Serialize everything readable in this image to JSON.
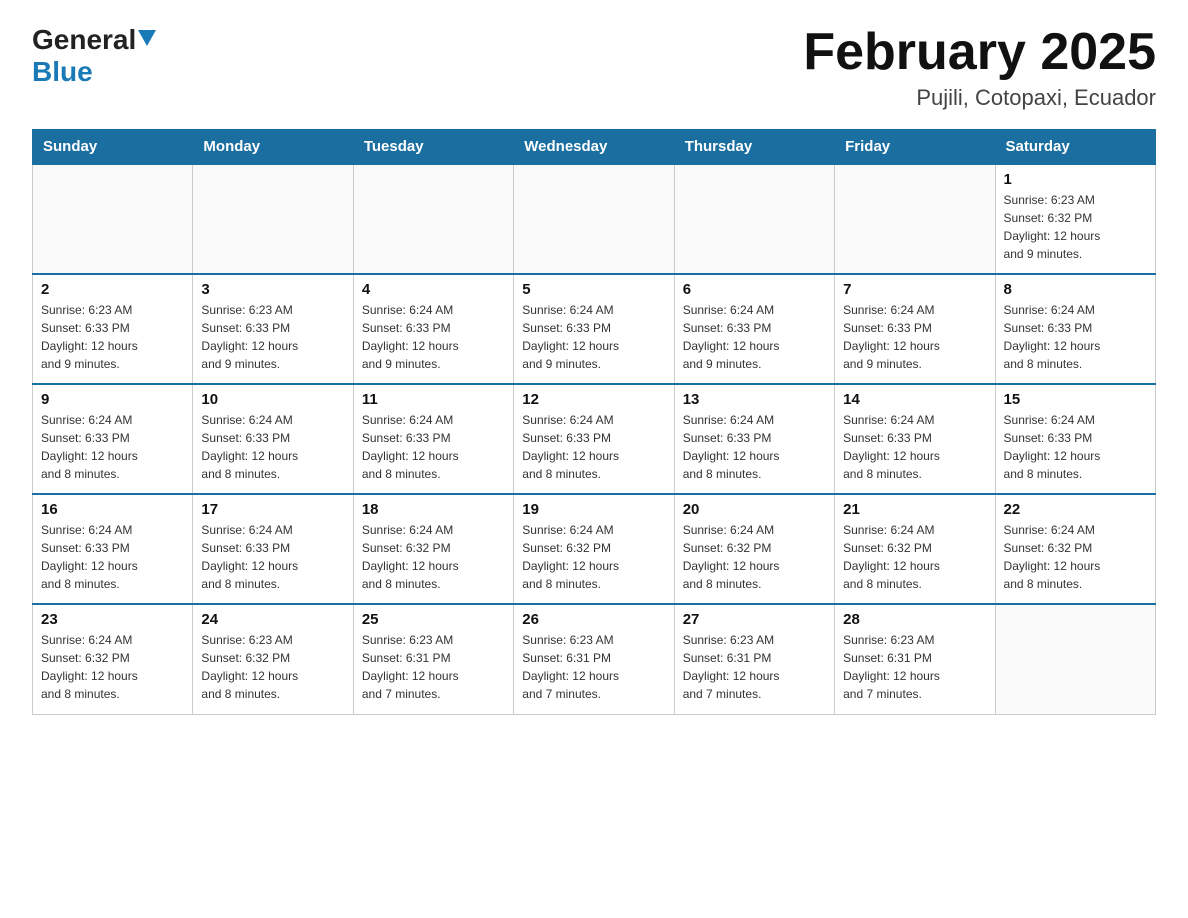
{
  "logo": {
    "general": "General",
    "blue": "Blue",
    "arrow_char": "▼"
  },
  "header": {
    "month_title": "February 2025",
    "location": "Pujili, Cotopaxi, Ecuador"
  },
  "weekdays": [
    "Sunday",
    "Monday",
    "Tuesday",
    "Wednesday",
    "Thursday",
    "Friday",
    "Saturday"
  ],
  "weeks": [
    {
      "days": [
        {
          "num": "",
          "info": ""
        },
        {
          "num": "",
          "info": ""
        },
        {
          "num": "",
          "info": ""
        },
        {
          "num": "",
          "info": ""
        },
        {
          "num": "",
          "info": ""
        },
        {
          "num": "",
          "info": ""
        },
        {
          "num": "1",
          "info": "Sunrise: 6:23 AM\nSunset: 6:32 PM\nDaylight: 12 hours\nand 9 minutes."
        }
      ]
    },
    {
      "days": [
        {
          "num": "2",
          "info": "Sunrise: 6:23 AM\nSunset: 6:33 PM\nDaylight: 12 hours\nand 9 minutes."
        },
        {
          "num": "3",
          "info": "Sunrise: 6:23 AM\nSunset: 6:33 PM\nDaylight: 12 hours\nand 9 minutes."
        },
        {
          "num": "4",
          "info": "Sunrise: 6:24 AM\nSunset: 6:33 PM\nDaylight: 12 hours\nand 9 minutes."
        },
        {
          "num": "5",
          "info": "Sunrise: 6:24 AM\nSunset: 6:33 PM\nDaylight: 12 hours\nand 9 minutes."
        },
        {
          "num": "6",
          "info": "Sunrise: 6:24 AM\nSunset: 6:33 PM\nDaylight: 12 hours\nand 9 minutes."
        },
        {
          "num": "7",
          "info": "Sunrise: 6:24 AM\nSunset: 6:33 PM\nDaylight: 12 hours\nand 9 minutes."
        },
        {
          "num": "8",
          "info": "Sunrise: 6:24 AM\nSunset: 6:33 PM\nDaylight: 12 hours\nand 8 minutes."
        }
      ]
    },
    {
      "days": [
        {
          "num": "9",
          "info": "Sunrise: 6:24 AM\nSunset: 6:33 PM\nDaylight: 12 hours\nand 8 minutes."
        },
        {
          "num": "10",
          "info": "Sunrise: 6:24 AM\nSunset: 6:33 PM\nDaylight: 12 hours\nand 8 minutes."
        },
        {
          "num": "11",
          "info": "Sunrise: 6:24 AM\nSunset: 6:33 PM\nDaylight: 12 hours\nand 8 minutes."
        },
        {
          "num": "12",
          "info": "Sunrise: 6:24 AM\nSunset: 6:33 PM\nDaylight: 12 hours\nand 8 minutes."
        },
        {
          "num": "13",
          "info": "Sunrise: 6:24 AM\nSunset: 6:33 PM\nDaylight: 12 hours\nand 8 minutes."
        },
        {
          "num": "14",
          "info": "Sunrise: 6:24 AM\nSunset: 6:33 PM\nDaylight: 12 hours\nand 8 minutes."
        },
        {
          "num": "15",
          "info": "Sunrise: 6:24 AM\nSunset: 6:33 PM\nDaylight: 12 hours\nand 8 minutes."
        }
      ]
    },
    {
      "days": [
        {
          "num": "16",
          "info": "Sunrise: 6:24 AM\nSunset: 6:33 PM\nDaylight: 12 hours\nand 8 minutes."
        },
        {
          "num": "17",
          "info": "Sunrise: 6:24 AM\nSunset: 6:33 PM\nDaylight: 12 hours\nand 8 minutes."
        },
        {
          "num": "18",
          "info": "Sunrise: 6:24 AM\nSunset: 6:32 PM\nDaylight: 12 hours\nand 8 minutes."
        },
        {
          "num": "19",
          "info": "Sunrise: 6:24 AM\nSunset: 6:32 PM\nDaylight: 12 hours\nand 8 minutes."
        },
        {
          "num": "20",
          "info": "Sunrise: 6:24 AM\nSunset: 6:32 PM\nDaylight: 12 hours\nand 8 minutes."
        },
        {
          "num": "21",
          "info": "Sunrise: 6:24 AM\nSunset: 6:32 PM\nDaylight: 12 hours\nand 8 minutes."
        },
        {
          "num": "22",
          "info": "Sunrise: 6:24 AM\nSunset: 6:32 PM\nDaylight: 12 hours\nand 8 minutes."
        }
      ]
    },
    {
      "days": [
        {
          "num": "23",
          "info": "Sunrise: 6:24 AM\nSunset: 6:32 PM\nDaylight: 12 hours\nand 8 minutes."
        },
        {
          "num": "24",
          "info": "Sunrise: 6:23 AM\nSunset: 6:32 PM\nDaylight: 12 hours\nand 8 minutes."
        },
        {
          "num": "25",
          "info": "Sunrise: 6:23 AM\nSunset: 6:31 PM\nDaylight: 12 hours\nand 7 minutes."
        },
        {
          "num": "26",
          "info": "Sunrise: 6:23 AM\nSunset: 6:31 PM\nDaylight: 12 hours\nand 7 minutes."
        },
        {
          "num": "27",
          "info": "Sunrise: 6:23 AM\nSunset: 6:31 PM\nDaylight: 12 hours\nand 7 minutes."
        },
        {
          "num": "28",
          "info": "Sunrise: 6:23 AM\nSunset: 6:31 PM\nDaylight: 12 hours\nand 7 minutes."
        },
        {
          "num": "",
          "info": ""
        }
      ]
    }
  ]
}
